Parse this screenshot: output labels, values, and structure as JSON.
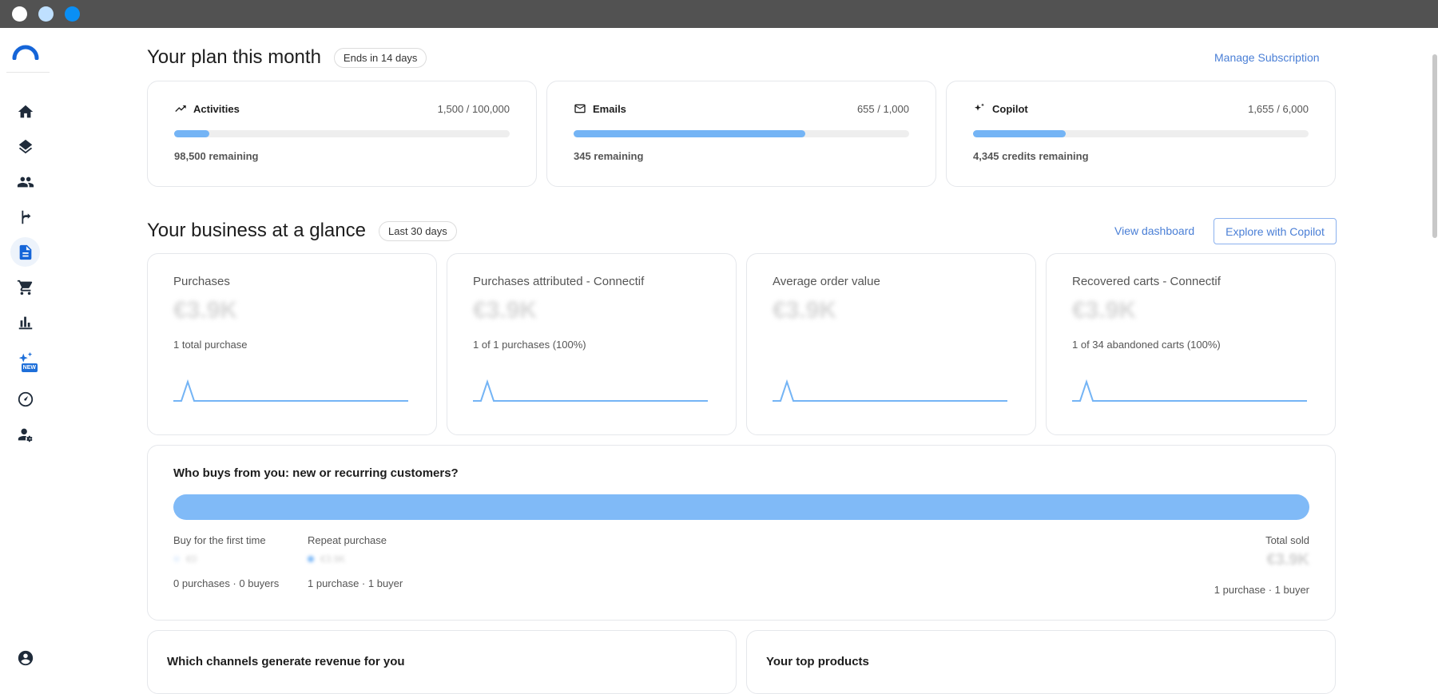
{
  "window": {
    "controls": [
      "close",
      "minimize",
      "maximize"
    ]
  },
  "sidebar": {
    "logo": "brand-logo",
    "items": [
      {
        "icon": "home-icon",
        "active": false
      },
      {
        "icon": "layers-icon",
        "active": false
      },
      {
        "icon": "people-icon",
        "active": false
      },
      {
        "icon": "flow-icon",
        "active": false
      },
      {
        "icon": "document-icon",
        "active": true
      },
      {
        "icon": "cart-icon",
        "active": false
      },
      {
        "icon": "bar-chart-icon",
        "active": false
      },
      {
        "icon": "sparkle-icon",
        "active": false,
        "badge": "NEW"
      },
      {
        "icon": "gauge-icon",
        "active": false
      },
      {
        "icon": "user-settings-icon",
        "active": false
      }
    ],
    "account_icon": "account-circle-icon"
  },
  "plan": {
    "title": "Your plan this month",
    "badge": "Ends in 14 days",
    "manage_link": "Manage Subscription",
    "cards": [
      {
        "icon": "trend-icon",
        "name": "Activities",
        "usage": "1,500 / 100,000",
        "fill": 0.105,
        "remaining": "98,500 remaining"
      },
      {
        "icon": "mail-icon",
        "name": "Emails",
        "usage": "655 / 1,000",
        "fill": 0.69,
        "remaining": "345 remaining"
      },
      {
        "icon": "sparkle-icon",
        "name": "Copilot",
        "usage": "1,655 / 6,000",
        "fill": 0.276,
        "remaining": "4,345 credits remaining"
      }
    ]
  },
  "business": {
    "title": "Your business at a glance",
    "badge": "Last 30 days",
    "view_link": "View dashboard",
    "explore_button": "Explore with Copilot",
    "metrics": [
      {
        "label": "Purchases",
        "value": "€3.9K",
        "sub": "1 total purchase"
      },
      {
        "label": "Purchases attributed - Connectif",
        "value": "€3.9K",
        "sub": "1 of 1 purchases (100%)"
      },
      {
        "label": "Average order value",
        "value": "€3.9K",
        "sub": ""
      },
      {
        "label": "Recovered carts - Connectif",
        "value": "€3.9K",
        "sub": "1 of 34 abandoned carts (100%)"
      }
    ],
    "spark_color": "#74b4f5"
  },
  "who": {
    "title": "Who buys from you: new or recurring customers?",
    "bar_color": "#80baf7",
    "first": {
      "label": "Buy for the first time",
      "value": "€0",
      "sub": "0 purchases · 0 buyers"
    },
    "repeat": {
      "label": "Repeat purchase",
      "value": "€3.9K",
      "sub": "1 purchase · 1 buyer"
    },
    "total": {
      "label": "Total sold",
      "value": "€3.9K",
      "sub": "1 purchase · 1 buyer"
    }
  },
  "bottom": {
    "channels_title": "Which channels generate revenue for you",
    "products_title": "Your top products"
  }
}
